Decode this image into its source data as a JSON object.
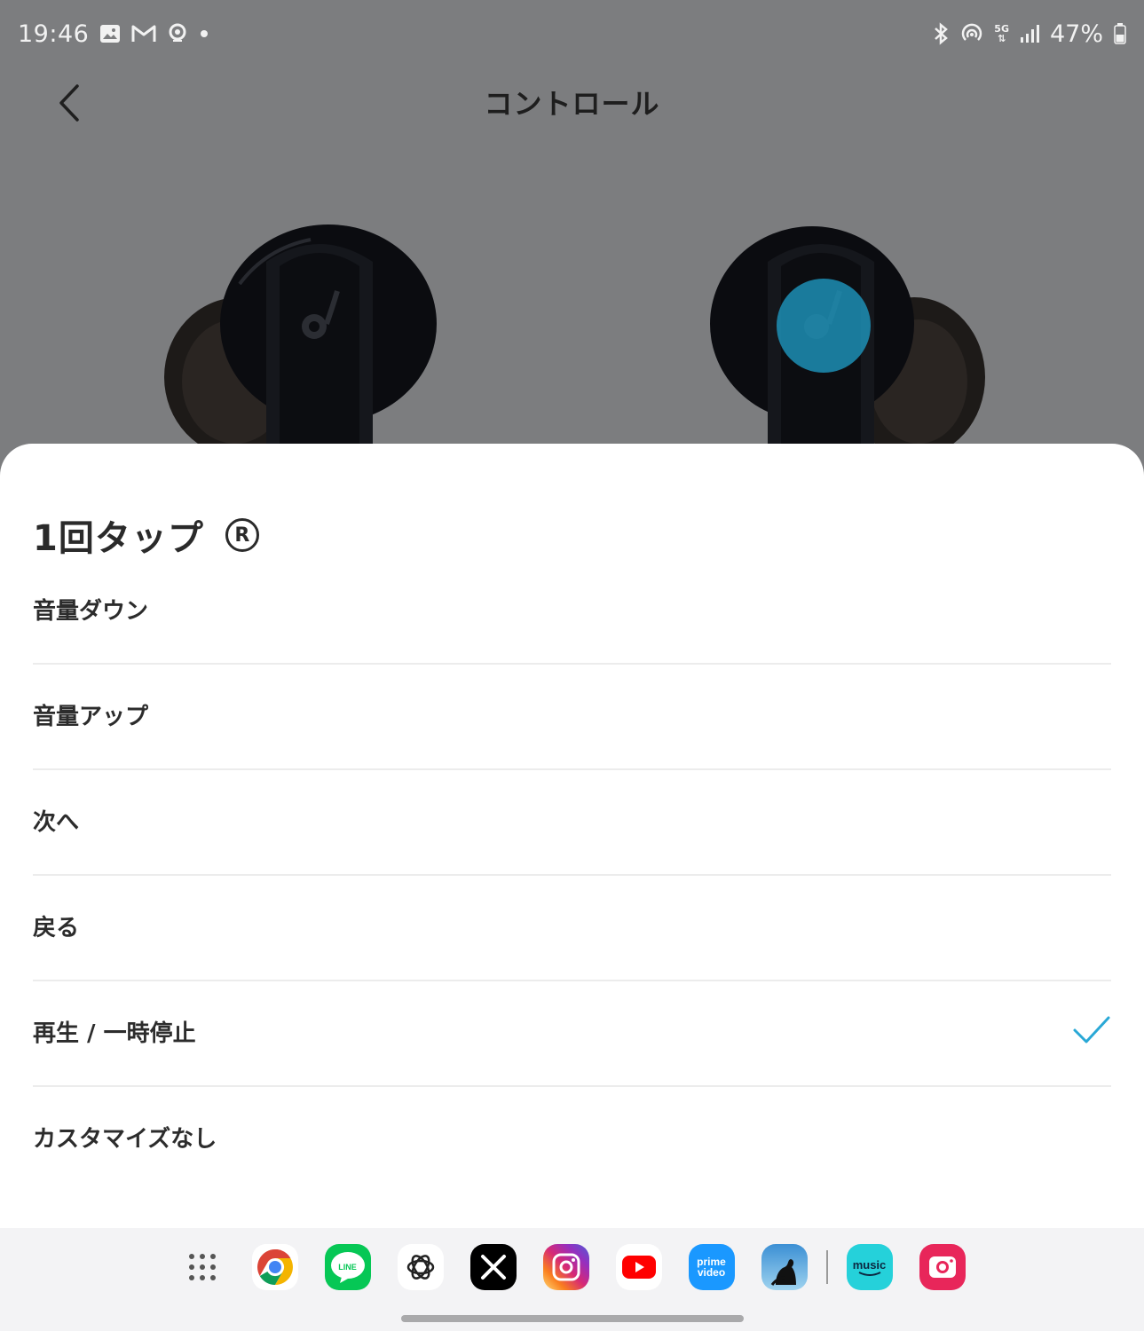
{
  "status_bar": {
    "time": "19:46",
    "battery_percent": "47%",
    "network": "5G",
    "left_icons": [
      "gallery-icon",
      "gmail-icon",
      "notification-app-icon",
      "dot-icon"
    ],
    "right_icons": [
      "bluetooth-icon",
      "hotspot-icon",
      "5g-icon",
      "signal-icon",
      "battery-icon"
    ]
  },
  "header": {
    "title": "コントロール",
    "back_icon": "chevron-left-icon"
  },
  "sheet": {
    "title": "1回タップ",
    "side_badge": "R",
    "options": [
      {
        "label": "音量ダウン",
        "selected": false
      },
      {
        "label": "音量アップ",
        "selected": false
      },
      {
        "label": "次へ",
        "selected": false
      },
      {
        "label": "戻る",
        "selected": false
      },
      {
        "label": "再生 / 一時停止",
        "selected": true
      },
      {
        "label": "カスタマイズなし",
        "selected": false
      }
    ]
  },
  "dock": {
    "apps": [
      {
        "name": "app-drawer-icon"
      },
      {
        "name": "chrome-icon"
      },
      {
        "name": "line-icon",
        "label": "LINE"
      },
      {
        "name": "chatgpt-icon"
      },
      {
        "name": "x-icon"
      },
      {
        "name": "instagram-icon"
      },
      {
        "name": "youtube-icon"
      },
      {
        "name": "prime-video-icon",
        "label": "prime video"
      },
      {
        "name": "kindle-icon"
      },
      {
        "name": "amazon-music-icon",
        "label": "music"
      },
      {
        "name": "camera-icon"
      }
    ]
  },
  "colors": {
    "accent": "#29a8d6",
    "overlay": "#7c7d7f",
    "sheet_bg": "#ffffff"
  }
}
